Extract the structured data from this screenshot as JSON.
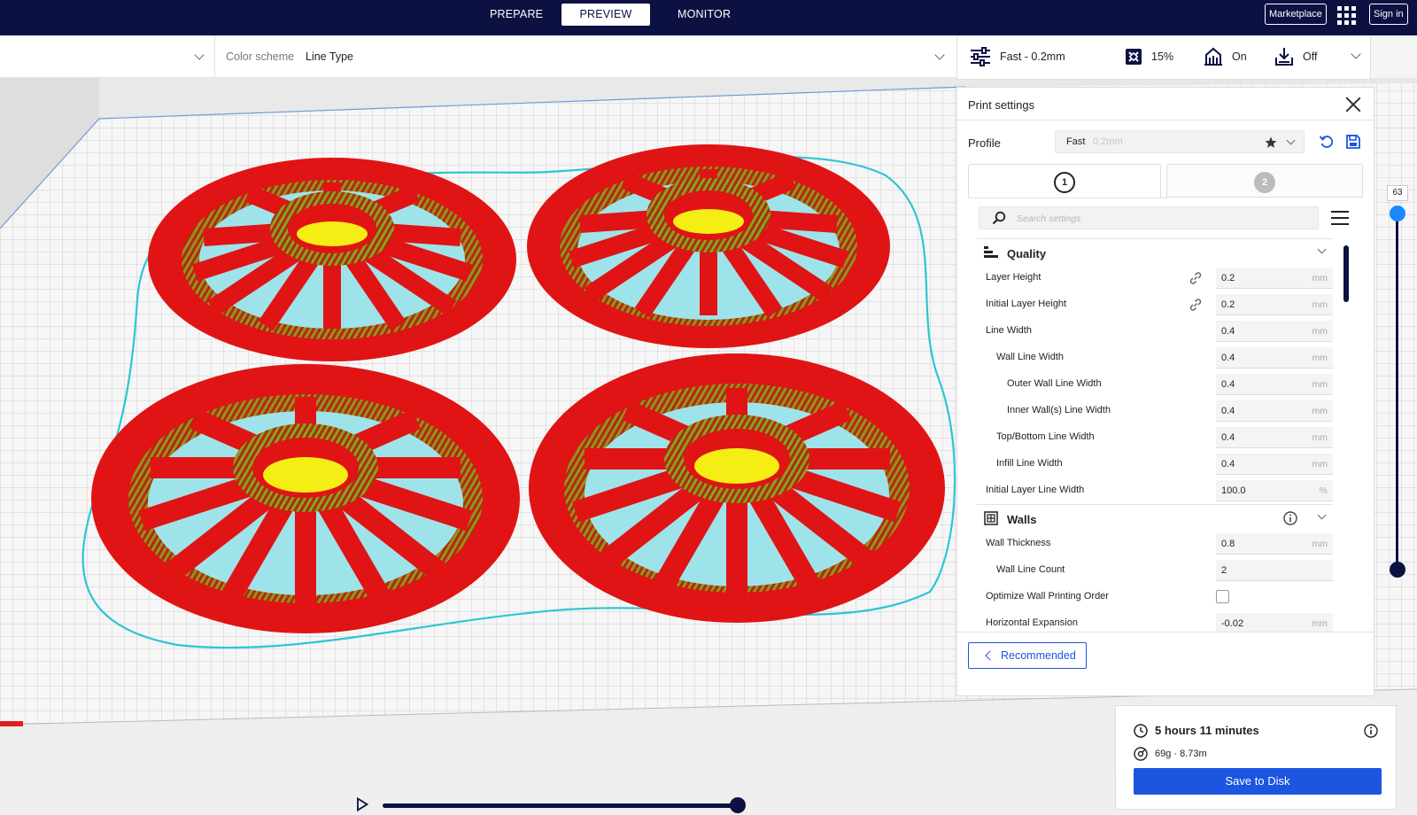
{
  "stages": {
    "prepare": "PREPARE",
    "preview": "PREVIEW",
    "monitor": "MONITOR"
  },
  "header": {
    "marketplace": "Marketplace",
    "sign_in": "Sign in"
  },
  "view_options": {
    "color_scheme_label": "Color scheme",
    "color_scheme_value": "Line Type"
  },
  "print_bar": {
    "profile": "Fast - 0.2mm",
    "infill": "15%",
    "support": "On",
    "adhesion": "Off"
  },
  "print_settings": {
    "title": "Print settings",
    "profile_label": "Profile",
    "profile_name": "Fast",
    "profile_sub": "0.2mm",
    "extruder_tabs": [
      "1",
      "2"
    ],
    "search_placeholder": "Search settings",
    "sections": {
      "quality": {
        "title": "Quality",
        "rows": [
          {
            "label": "Layer Height",
            "value": "0.2",
            "unit": "mm"
          },
          {
            "label": "Initial Layer Height",
            "value": "0.2",
            "unit": "mm"
          },
          {
            "label": "Line Width",
            "value": "0.4",
            "unit": "mm"
          },
          {
            "label": "Wall Line Width",
            "value": "0.4",
            "unit": "mm"
          },
          {
            "label": "Outer Wall Line Width",
            "value": "0.4",
            "unit": "mm"
          },
          {
            "label": "Inner Wall(s) Line Width",
            "value": "0.4",
            "unit": "mm"
          },
          {
            "label": "Top/Bottom Line Width",
            "value": "0.4",
            "unit": "mm"
          },
          {
            "label": "Infill Line Width",
            "value": "0.4",
            "unit": "mm"
          },
          {
            "label": "Initial Layer Line Width",
            "value": "100.0",
            "unit": "%"
          }
        ]
      },
      "walls": {
        "title": "Walls",
        "rows": [
          {
            "label": "Wall Thickness",
            "value": "0.8",
            "unit": "mm"
          },
          {
            "label": "Wall Line Count",
            "value": "2",
            "unit": ""
          },
          {
            "label": "Optimize Wall Printing Order",
            "value": "",
            "unit": ""
          },
          {
            "label": "Horizontal Expansion",
            "value": "-0.02",
            "unit": "mm"
          }
        ]
      }
    },
    "recommended": "Recommended"
  },
  "layer_slider": {
    "current_layer": "63"
  },
  "estimate": {
    "time": "5 hours 11 minutes",
    "material": "69g · 8.73m",
    "save": "Save to Disk"
  },
  "colors": {
    "navy": "#0c1142",
    "accent": "#1c55e0",
    "wall_red": "#ee1c1c",
    "inner_green": "#3fbf2a",
    "skin_yellow": "#f4ee14",
    "support_cyan": "#7fe6ea",
    "skirt_cyan": "#2cc6d2"
  },
  "icons": [
    "settings-sliders-icon",
    "infill-icon",
    "support-icon",
    "adhesion-icon",
    "star-icon",
    "reset-icon",
    "save-icon",
    "search-icon",
    "menu-icon",
    "link-icon",
    "info-icon",
    "clock-icon",
    "spool-icon",
    "play-icon",
    "close-icon"
  ]
}
